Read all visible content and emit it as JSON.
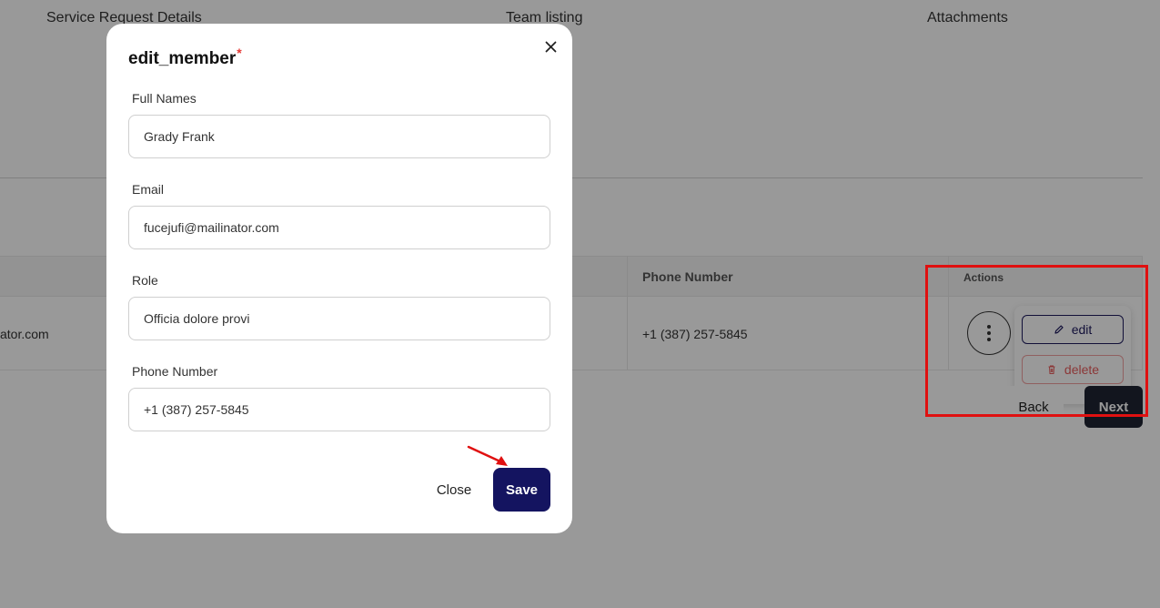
{
  "tabs": [
    {
      "label": "Service Request Details"
    },
    {
      "label": "Team listing"
    },
    {
      "label": "Attachments"
    }
  ],
  "table": {
    "headers": {
      "phone": "Phone Number",
      "actions": "Actions"
    },
    "row": {
      "email_partial": "ator.com",
      "phone": "+1 (387) 257-5845"
    }
  },
  "actions_menu": {
    "edit_label": "edit",
    "delete_label": "delete"
  },
  "nav": {
    "back_label": "Back",
    "next_label": "Next"
  },
  "modal": {
    "title": "edit_member",
    "required_mark": "*",
    "fields": [
      {
        "label": "Full Names",
        "value": "Grady Frank"
      },
      {
        "label": "Email",
        "value": "fucejufi@mailinator.com"
      },
      {
        "label": "Role",
        "value": "Officia dolore provi"
      },
      {
        "label": "Phone Number",
        "value": "+1 (387) 257-5845"
      }
    ],
    "close_label": "Close",
    "save_label": "Save"
  },
  "colors": {
    "primary": "#141460",
    "danger": "#e85c5c",
    "annotation": "#e01010",
    "next_button": "#1f2433"
  },
  "icons": [
    "close-icon",
    "pencil-icon",
    "trash-icon",
    "kebab-menu-icon",
    "annotation-arrow"
  ]
}
